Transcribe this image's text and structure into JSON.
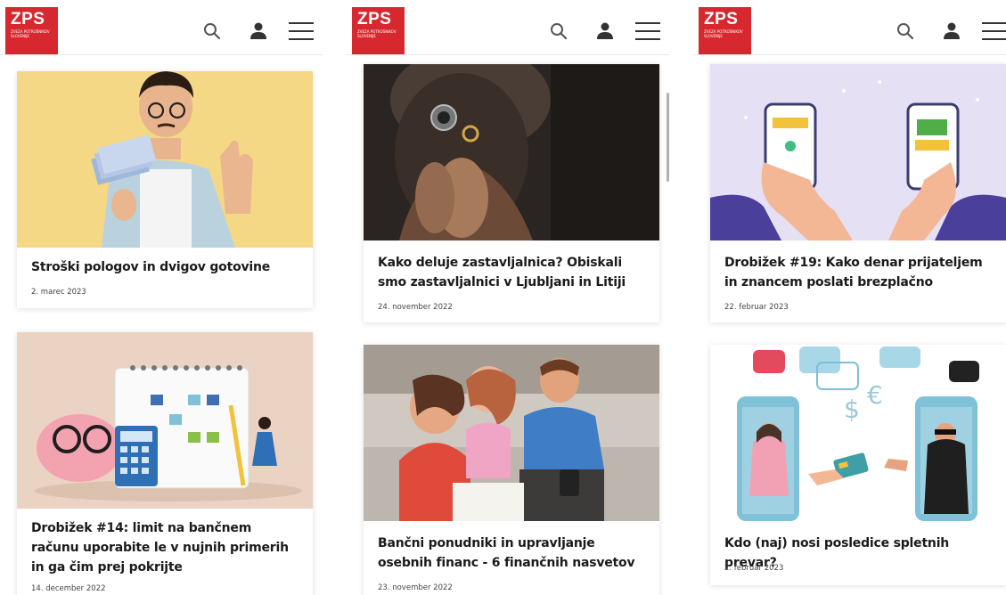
{
  "logo": {
    "text": "ZPS",
    "subtitle": "ZVEZA POTROŠNIKOV SLOVENIJE"
  },
  "columns": [
    {
      "cards": [
        {
          "title": "Stroški pologov in dvigov gotovine",
          "date": "2. marec 2023",
          "image": "man-refusing-cash-photo"
        },
        {
          "title": "Drobižek #14: limit na bančnem računu uporabite le v nujnih primerih in ga čim prej pokrijte",
          "date": "14. december 2022",
          "image": "piggy-bank-calendar-illustration"
        }
      ]
    },
    {
      "cards": [
        {
          "title": "Kako deluje zastavljalnica? Obiskali smo zastavljalnici v Ljubljani in Litiji",
          "date": "24. november 2022",
          "image": "jeweler-loupe-ring-photo"
        },
        {
          "title": "Bančni ponudniki in upravljanje osebnih financ - 6 finančnih nasvetov",
          "date": "23. november 2022",
          "image": "family-on-sofa-photo"
        }
      ]
    },
    {
      "cards": [
        {
          "title": "Drobižek #19: Kako denar prijateljem in znancem poslati brezplačno",
          "date": "22. februar 2023",
          "image": "phones-money-transfer-illustration"
        },
        {
          "title": "Kdo (naj) nosi posledice spletnih prevar?",
          "date": "2. februar 2023",
          "image": "online-scam-illustration"
        }
      ]
    }
  ],
  "colors": {
    "brand": "#d7282f",
    "title": "#1b1b1b"
  },
  "icons": [
    "search-icon",
    "user-icon",
    "menu-icon"
  ]
}
